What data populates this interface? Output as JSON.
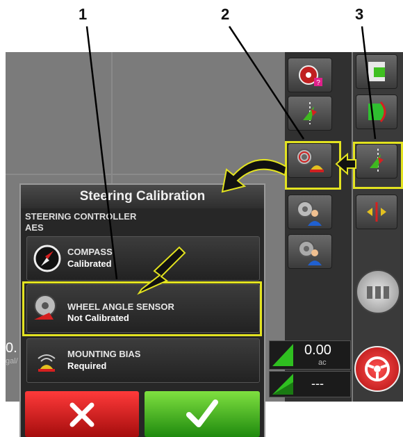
{
  "callouts": [
    "1",
    "2",
    "3"
  ],
  "dialog": {
    "title": "Steering Calibration",
    "section_label": "STEERING CONTROLLER",
    "section_value": "AES",
    "rows": [
      {
        "name": "COMPASS",
        "status": "Calibrated"
      },
      {
        "name": "WHEEL ANGLE SENSOR",
        "status": "Not Calibrated"
      },
      {
        "name": "MOUNTING BIAS",
        "status": "Required"
      }
    ]
  },
  "readouts": {
    "area_value": "0.00",
    "area_unit": "ac",
    "second_value": "---",
    "left_partial": "0.",
    "left_partial_unit": "gal/"
  },
  "colors": {
    "highlight": "#e3e320",
    "cancel": "#d11a1a",
    "confirm": "#3fae1f"
  },
  "icons": [
    "steering-wheel-help-icon",
    "guidance-line-icon",
    "wheel-sensor-icon",
    "wheel-sensor-user-icon",
    "steering-user-icon",
    "map-green-icon",
    "curve-path-icon",
    "guidance-arrow-icon",
    "move-arrows-icon",
    "gear-shift-icon",
    "steering-engage-icon"
  ]
}
